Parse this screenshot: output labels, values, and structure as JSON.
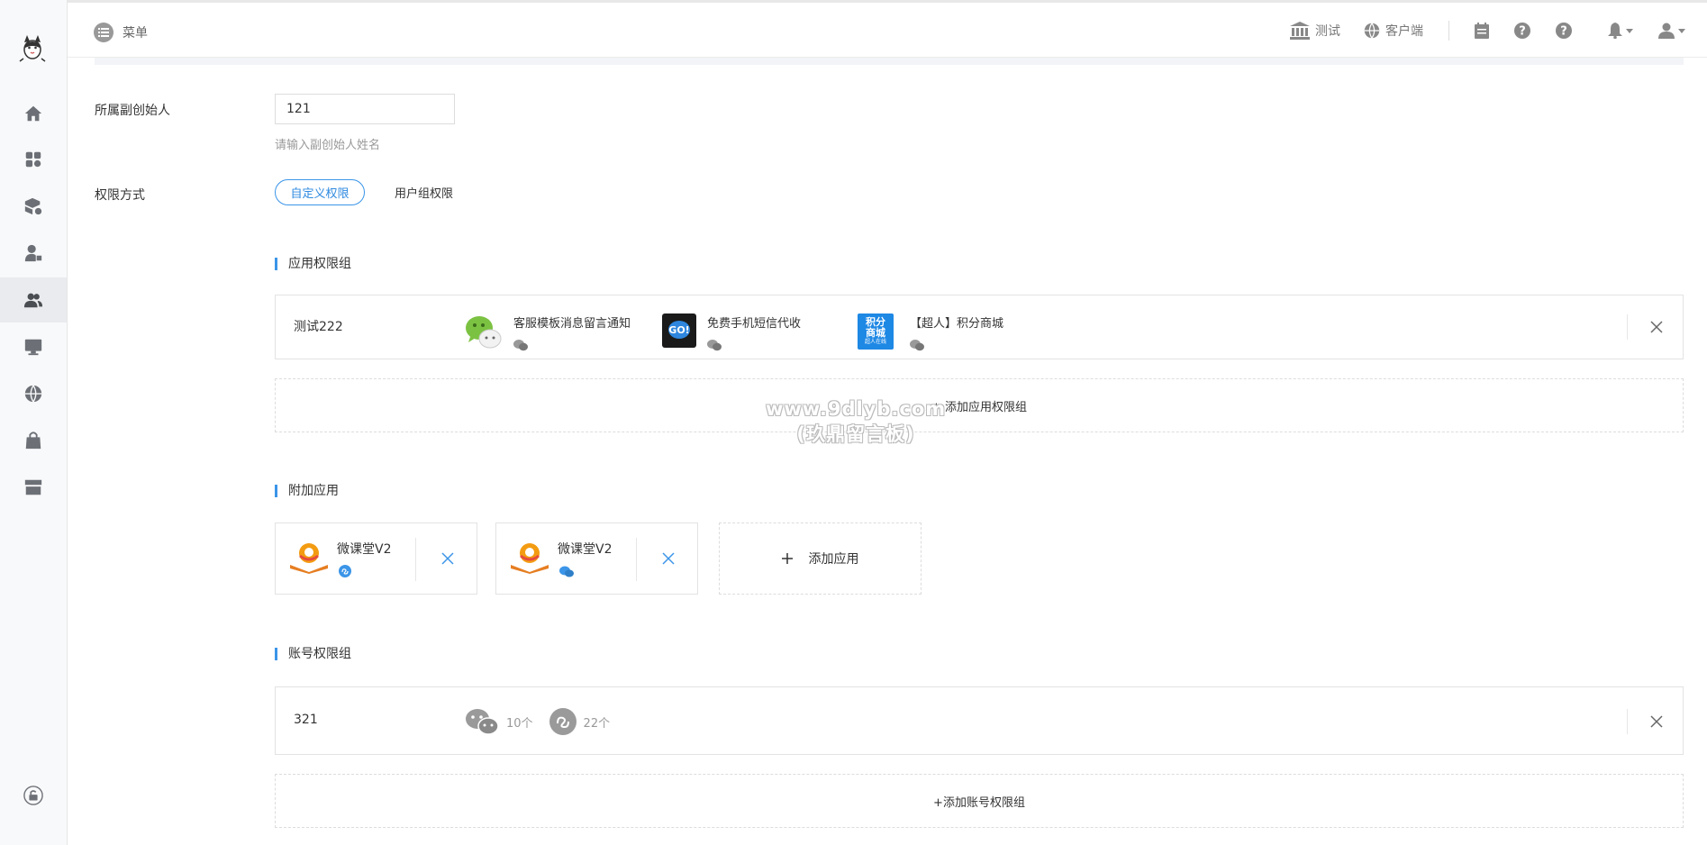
{
  "topbar": {
    "menu_label": "菜单",
    "links": [
      {
        "label": "测试",
        "icon": "bank-icon"
      },
      {
        "label": "客户端",
        "icon": "globe-icon"
      }
    ],
    "icons": [
      "calendar-icon",
      "help-icon",
      "help-icon-2",
      "bell-icon",
      "user-icon"
    ]
  },
  "sidebar": {
    "items": [
      {
        "name": "home-icon"
      },
      {
        "name": "apps-icon"
      },
      {
        "name": "module-settings-icon"
      },
      {
        "name": "user-lock-icon"
      },
      {
        "name": "users-icon",
        "active": true
      },
      {
        "name": "monitor-icon"
      },
      {
        "name": "globe-icon"
      },
      {
        "name": "bag-icon"
      },
      {
        "name": "store-icon"
      }
    ],
    "bottom_icon": "lock-icon"
  },
  "form": {
    "founder_label": "所属副创始人",
    "founder_value": "121",
    "founder_help": "请输入副创始人姓名",
    "permission_label": "权限方式",
    "permission_options": [
      "自定义权限",
      "用户组权限"
    ],
    "permission_selected": "自定义权限"
  },
  "app_group": {
    "section_title": "应用权限组",
    "group_name": "测试222",
    "apps": [
      {
        "name": "客服模板消息留言通知",
        "icon": "wechat-bubble-icon"
      },
      {
        "name": "免费手机短信代收",
        "icon": "sms-go-icon"
      },
      {
        "name": "【超人】积分商城",
        "icon": "points-mall-icon",
        "icon_text": "积分商城",
        "icon_sub": "超人在线"
      }
    ],
    "add_label": "+ 添加应用权限组"
  },
  "extra_apps": {
    "section_title": "附加应用",
    "apps": [
      {
        "name": "微课堂V2",
        "platform": "miniprogram-icon"
      },
      {
        "name": "微课堂V2",
        "platform": "wechat-icon"
      }
    ],
    "add_label": "添加应用"
  },
  "account_group": {
    "section_title": "账号权限组",
    "group_name": "321",
    "wechat_count": "10个",
    "miniprogram_count": "22个",
    "add_label": "+添加账号权限组"
  },
  "watermark": {
    "line1": "www.9dlyb.com",
    "line2": "(玖鼎留言板)"
  },
  "colors": {
    "accent": "#3b95e8",
    "sidebar_bg": "#f8f9fa",
    "border": "#e3e3e3"
  }
}
